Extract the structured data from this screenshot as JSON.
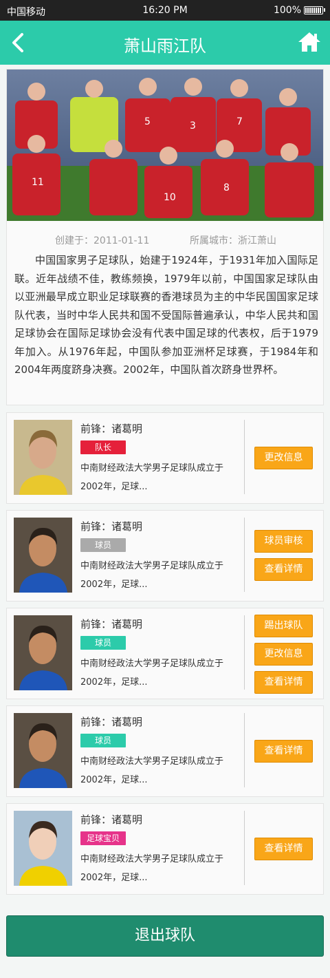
{
  "status_bar": {
    "carrier": "中国移动",
    "time": "16:20 PM",
    "battery": "100%",
    "battery_level": 1.0
  },
  "nav": {
    "title": "萧山雨江队",
    "back_icon": "chevron-left-icon",
    "home_icon": "home-icon"
  },
  "team": {
    "created": "创建于：2011-01-11",
    "city": "所属城市：浙江萧山",
    "description": "中国国家男子足球队，始建于1924年，于1931年加入国际足联。近年战绩不佳，教练频换，1979年以前，中国国家足球队由以亚洲最早成立职业足球联赛的香港球员为主的中华民国国家足球队代表，当时中华人民共和国不受国际普遍承认，中华人民共和国足球协会在国际足球协会没有代表中国足球的代表权，后于1979年加入。从1976年起，中国队参加亚洲杯足球赛，于1984年和2004年两度跻身决赛。2002年，中国队首次跻身世界杯。"
  },
  "players": [
    {
      "name": "前锋：诸葛明",
      "role": "队长",
      "role_color": "#e5203a",
      "desc": "中南财经政法大学男子足球队成立于2002年，足球...",
      "buttons": [
        "更改信息"
      ]
    },
    {
      "name": "前锋：诸葛明",
      "role": "球员",
      "role_color": "#aaaaaa",
      "desc": "中南财经政法大学男子足球队成立于2002年，足球...",
      "buttons": [
        "球员审核",
        "查看详情"
      ]
    },
    {
      "name": "前锋：诸葛明",
      "role": "球员",
      "role_color": "#2ccbaa",
      "desc": "中南财经政法大学男子足球队成立于2002年，足球...",
      "buttons": [
        "踢出球队",
        "更改信息",
        "查看详情"
      ]
    },
    {
      "name": "前锋：诸葛明",
      "role": "球员",
      "role_color": "#2ccbaa",
      "desc": "中南财经政法大学男子足球队成立于2002年，足球...",
      "buttons": [
        "查看详情"
      ]
    },
    {
      "name": "前锋：诸葛明",
      "role": "足球宝贝",
      "role_color": "#e6338a",
      "desc": "中南财经政法大学男子足球队成立于2002年，足球...",
      "buttons": [
        "查看详情"
      ]
    }
  ],
  "exit_button": "退出球队"
}
